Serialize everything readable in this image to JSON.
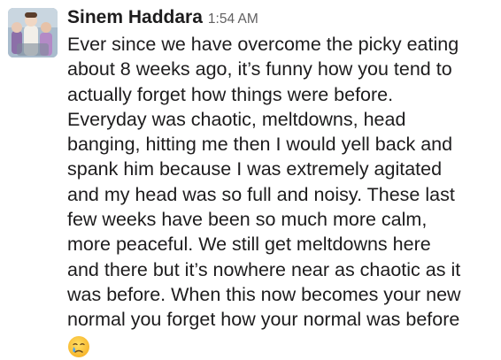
{
  "message": {
    "sender": "Sinem Haddara",
    "timestamp": "1:54 AM",
    "lines": [
      "Ever since we have overcome the picky eating",
      "about 8 weeks ago, it’s funny how you tend to",
      "actually forget how things were before.",
      "Everyday was chaotic, meltdowns, head",
      "banging, hitting me then I would yell back and",
      "spank him because I was extremely agitated",
      "and my head was so full and noisy. These last",
      "few weeks have been so much more calm,",
      "more peaceful. We still get meltdowns here",
      "and there but it’s nowhere near as chaotic as it",
      "was before. When this now becomes your new",
      "normal you forget how your normal was before"
    ],
    "emoji": "crying-face-icon"
  }
}
